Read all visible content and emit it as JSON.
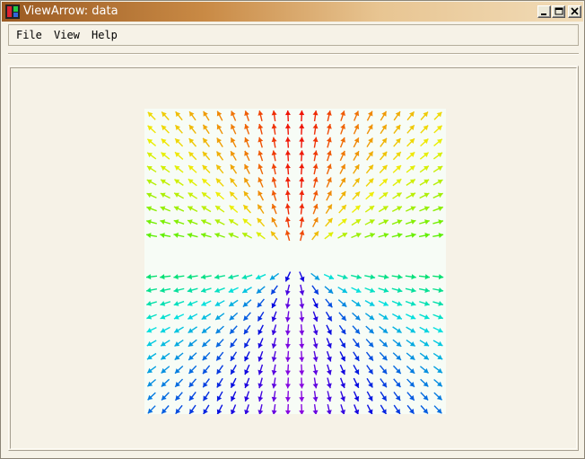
{
  "window": {
    "title": "ViewArrow: data",
    "controls": [
      "minimize",
      "maximize",
      "close"
    ]
  },
  "menu": {
    "items": [
      "File",
      "View",
      "Help"
    ]
  },
  "plot": {
    "type": "vector-field",
    "grid": {
      "cols": 22,
      "rows": 22
    },
    "background": "#f7fcf6",
    "colors": {
      "top_center": "#e00000",
      "bottom_center": "#6a0090",
      "horizontal_top": "#20c040",
      "horizontal_bottom": "#20d060"
    }
  }
}
